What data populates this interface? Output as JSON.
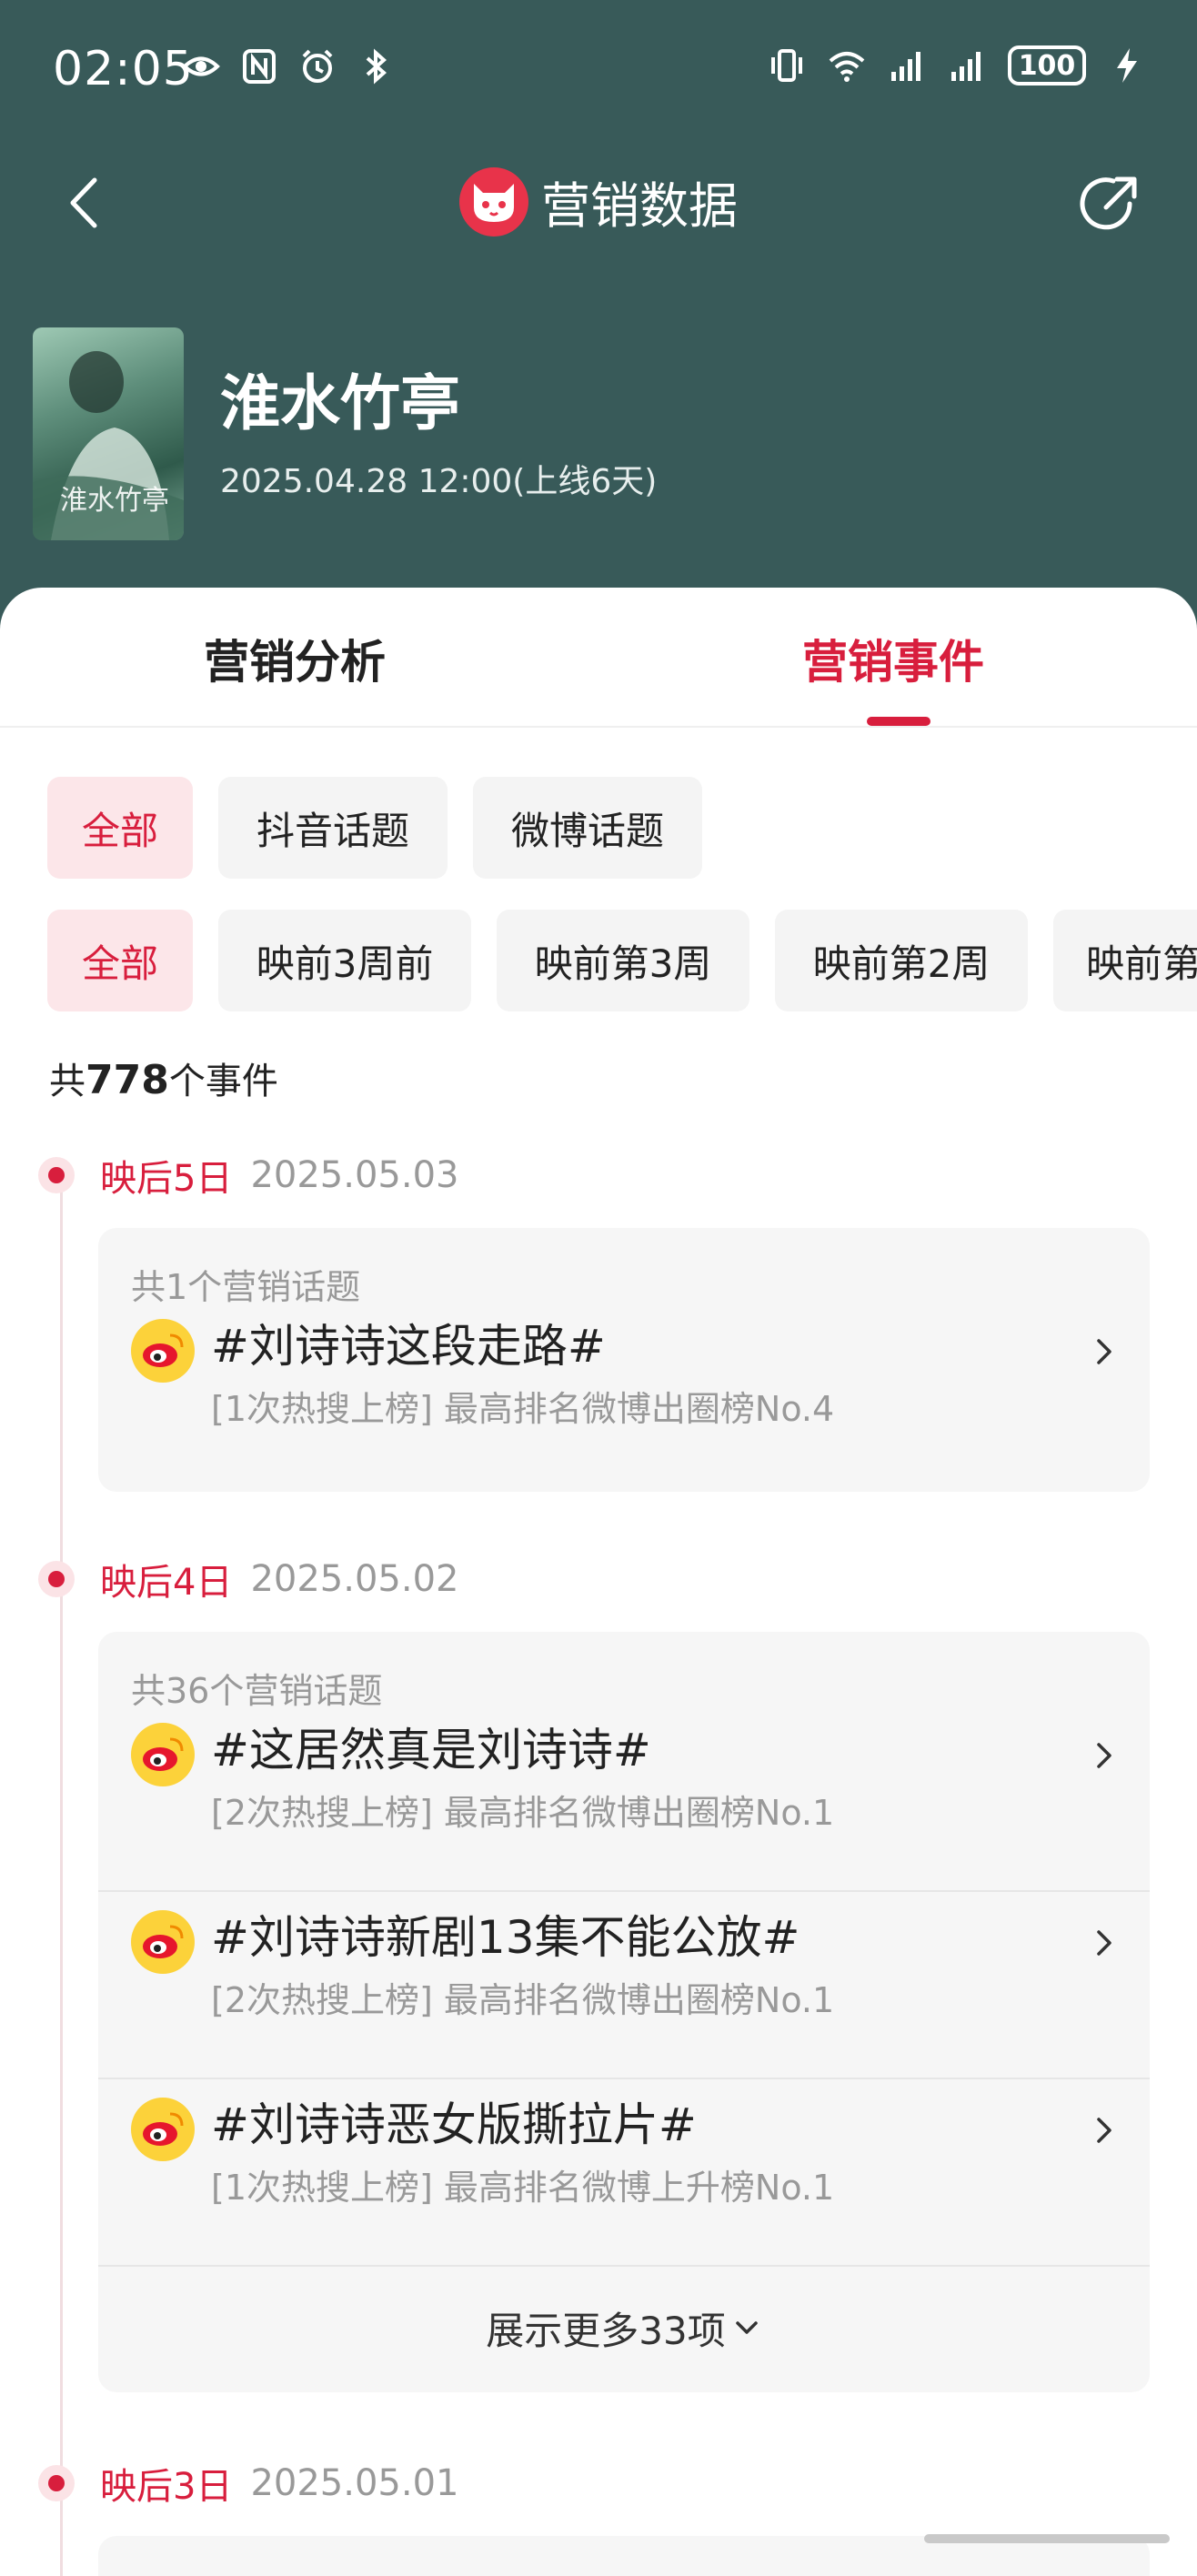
{
  "status_bar": {
    "time": "02:05",
    "battery": "100",
    "icons_left": [
      "eye-icon",
      "nfc-icon",
      "alarm-icon",
      "bluetooth-icon"
    ],
    "icons_right": [
      "vibrate-icon",
      "wifi-icon",
      "signal-icon",
      "signal-icon",
      "battery-icon",
      "charging-icon"
    ]
  },
  "nav": {
    "title": "营销数据",
    "back_icon": "chevron-left-icon",
    "share_icon": "share-icon"
  },
  "movie": {
    "title": "淮水竹亭",
    "release": "2025.04.28 12:00(上线6天)"
  },
  "tabs": [
    {
      "label": "营销分析",
      "active": false
    },
    {
      "label": "营销事件",
      "active": true
    }
  ],
  "platform_filters": [
    {
      "label": "全部",
      "active": true
    },
    {
      "label": "抖音话题",
      "active": false
    },
    {
      "label": "微博话题",
      "active": false
    }
  ],
  "period_filters": [
    {
      "label": "全部",
      "active": true
    },
    {
      "label": "映前3周前",
      "active": false
    },
    {
      "label": "映前第3周",
      "active": false
    },
    {
      "label": "映前第2周",
      "active": false
    },
    {
      "label": "映前第",
      "active": false
    }
  ],
  "total": {
    "prefix": "共",
    "count": "778",
    "suffix": "个事件"
  },
  "days": [
    {
      "label": "映后5日",
      "date": "2025.05.03",
      "count_text": "共1个营销话题",
      "topics": [
        {
          "title": "#刘诗诗这段走路#",
          "sub": "[1次热搜上榜] 最高排名微博出圈榜No.4"
        }
      ]
    },
    {
      "label": "映后4日",
      "date": "2025.05.02",
      "count_text": "共36个营销话题",
      "topics": [
        {
          "title": "#这居然真是刘诗诗#",
          "sub": "[2次热搜上榜] 最高排名微博出圈榜No.1"
        },
        {
          "title": "#刘诗诗新剧13集不能公放#",
          "sub": "[2次热搜上榜] 最高排名微博出圈榜No.1"
        },
        {
          "title": "#刘诗诗恶女版撕拉片#",
          "sub": "[1次热搜上榜] 最高排名微博上升榜No.1"
        }
      ],
      "show_more": "展示更多33项"
    },
    {
      "label": "映后3日",
      "date": "2025.05.01"
    }
  ],
  "colors": {
    "header_bg": "#385a59",
    "accent": "#d81e3d",
    "chip_active_bg": "#fce6e9",
    "weibo_yellow": "#fcd23a"
  }
}
